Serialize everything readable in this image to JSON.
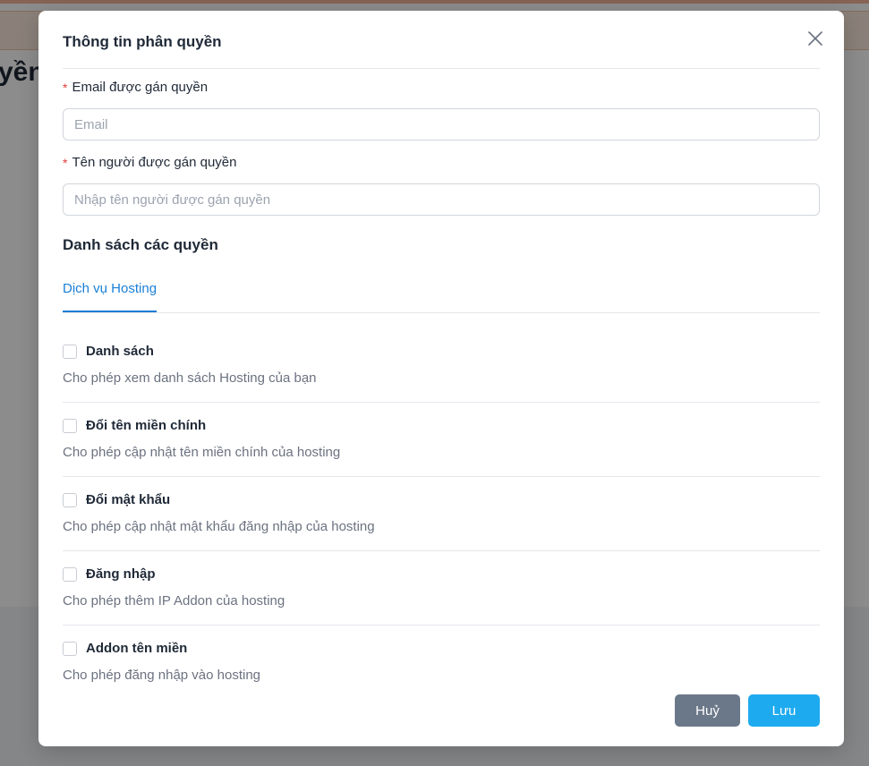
{
  "background": {
    "heading_fragment": "yền"
  },
  "modal": {
    "title": "Thông tin phân quyền",
    "close_icon": "close-icon",
    "email_field": {
      "required_mark": "*",
      "label": "Email được gán quyền",
      "placeholder": "Email",
      "value": ""
    },
    "name_field": {
      "required_mark": "*",
      "label": "Tên người được gán quyền",
      "placeholder": "Nhập tên người được gán quyền",
      "value": ""
    },
    "permissions_title": "Danh sách các quyền",
    "tabs": [
      {
        "label": "Dịch vụ Hosting",
        "active": true
      }
    ],
    "permissions": [
      {
        "name": "Danh sách",
        "description": "Cho phép xem danh sách Hosting của bạn",
        "checked": false
      },
      {
        "name": "Đổi tên miền chính",
        "description": "Cho phép cập nhật tên miền chính của hosting",
        "checked": false
      },
      {
        "name": "Đổi mật khẩu",
        "description": "Cho phép cập nhật mật khẩu đăng nhập của hosting",
        "checked": false
      },
      {
        "name": "Đăng nhập",
        "description": "Cho phép thêm IP Addon của hosting",
        "checked": false
      },
      {
        "name": "Addon tên miền",
        "description": "Cho phép đăng nhập vào hosting",
        "checked": false
      }
    ],
    "buttons": {
      "cancel_label": "Huỷ",
      "save_label": "Lưu"
    }
  },
  "colors": {
    "accent": "#1a7fd6",
    "save_button": "#1eaaef",
    "cancel_button": "#6b7889",
    "required": "#e53e3e"
  }
}
